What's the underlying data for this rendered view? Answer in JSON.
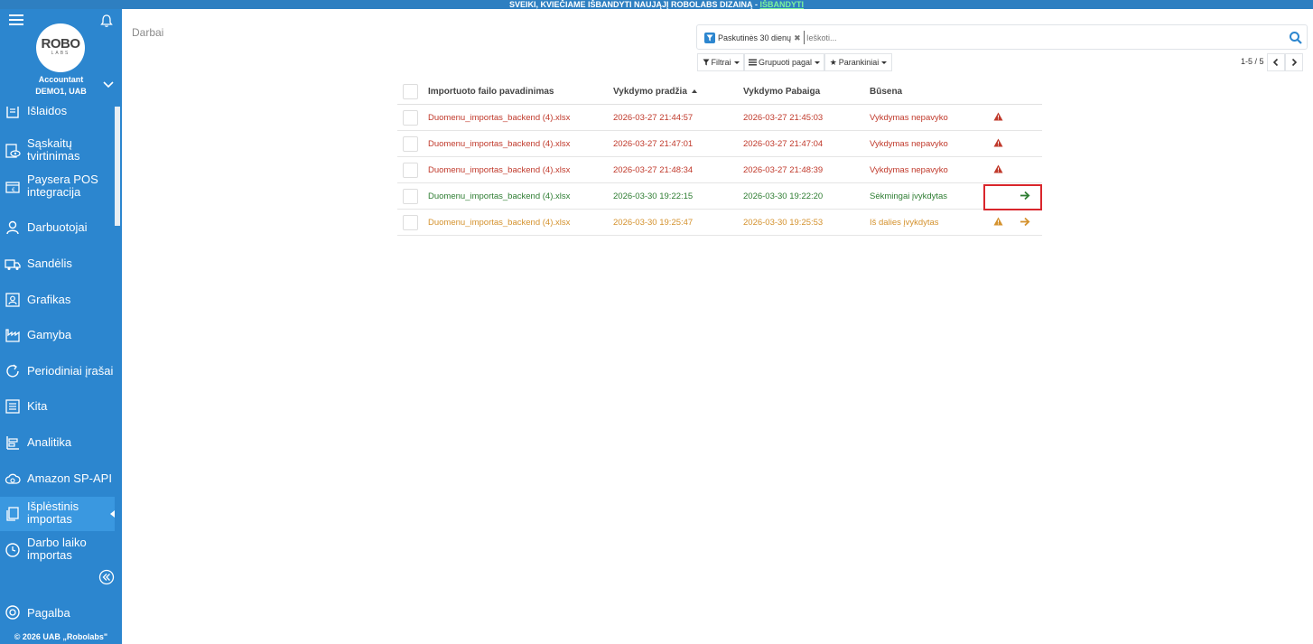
{
  "banner": {
    "text": "SVEIKI, KVIEČIAME IŠBANDYTI NAUJĄJĮ ROBOLABS DIZAINĄ - ",
    "link": "IŠBANDYTI"
  },
  "logo": {
    "main": "ROBO",
    "sub": "LABS"
  },
  "account": {
    "role": "Accountant",
    "company": "DEMO1, UAB"
  },
  "sidebar": {
    "items": [
      {
        "label": "Išlaidos",
        "icon": "receipt-icon"
      },
      {
        "label": "Sąskaitų tvirtinimas",
        "icon": "eye-icon"
      },
      {
        "label": "Paysera POS integracija",
        "icon": "wallet-icon"
      },
      {
        "label": "Darbuotojai",
        "icon": "user-icon"
      },
      {
        "label": "Sandėlis",
        "icon": "truck-icon"
      },
      {
        "label": "Grafikas",
        "icon": "id-card-icon"
      },
      {
        "label": "Gamyba",
        "icon": "factory-icon"
      },
      {
        "label": "Periodiniai įrašai",
        "icon": "refresh-icon"
      },
      {
        "label": "Kita",
        "icon": "list-icon"
      },
      {
        "label": "Analitika",
        "icon": "chart-icon"
      },
      {
        "label": "Amazon SP-API",
        "icon": "cloud-icon"
      },
      {
        "label": "Išplėstinis importas",
        "icon": "files-icon"
      },
      {
        "label": "Darbo laiko importas",
        "icon": "clock-icon"
      }
    ],
    "help": "Pagalba",
    "copyright": "© 2026 UAB „Robolabs\""
  },
  "main": {
    "title": "Darbai",
    "search": {
      "chip": "Paskutinės 30 dienų",
      "placeholder": "Ieškoti..."
    },
    "toolbar": {
      "filters": "Filtrai",
      "group_by": "Grupuoti pagal",
      "favorites": "Parankiniai"
    },
    "pager": "1-5 / 5"
  },
  "table": {
    "headers": {
      "file": "Importuoto failo pavadinimas",
      "start": "Vykdymo pradžia",
      "end": "Vykdymo Pabaiga",
      "status": "Būsena"
    },
    "rows": [
      {
        "file": "Duomenu_importas_backend (4).xlsx",
        "start": "2026-03-27 21:44:57",
        "end": "2026-03-27 21:45:03",
        "status": "Vykdymas nepavyko"
      },
      {
        "file": "Duomenu_importas_backend (4).xlsx",
        "start": "2026-03-27 21:47:01",
        "end": "2026-03-27 21:47:04",
        "status": "Vykdymas nepavyko"
      },
      {
        "file": "Duomenu_importas_backend (4).xlsx",
        "start": "2026-03-27 21:48:34",
        "end": "2026-03-27 21:48:39",
        "status": "Vykdymas nepavyko"
      },
      {
        "file": "Duomenu_importas_backend (4).xlsx",
        "start": "2026-03-30 19:22:15",
        "end": "2026-03-30 19:22:20",
        "status": "Sėkmingai įvykdytas"
      },
      {
        "file": "Duomenu_importas_backend (4).xlsx",
        "start": "2026-03-30 19:25:47",
        "end": "2026-03-30 19:25:53",
        "status": "Iš dalies įvykdytas"
      }
    ]
  },
  "colors": {
    "failed": "#c0392b",
    "success": "#2e7d32",
    "partial": "#d4922e",
    "sidebar": "#2c86cf",
    "highlight": "#d9262c"
  }
}
